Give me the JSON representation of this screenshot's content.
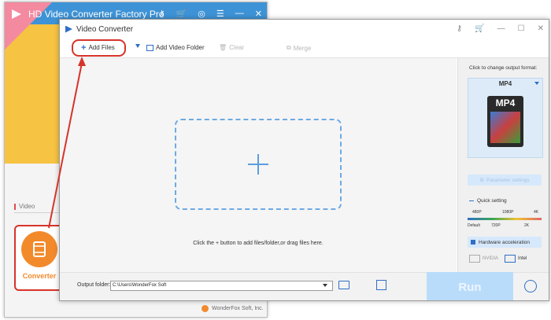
{
  "background_app": {
    "title": "HD Video Converter Factory Pro",
    "title_icons": [
      "key-icon",
      "cart-icon",
      "globe-icon",
      "menu-icon",
      "minimize-icon",
      "close-icon"
    ],
    "video_tab": "Video",
    "converter_label": "Converter",
    "footer": "WonderFox Soft, Inc."
  },
  "window": {
    "title": "Video Converter",
    "title_icons": [
      "key-icon",
      "cart-icon",
      "minimize-icon",
      "maximize-icon",
      "close-icon"
    ]
  },
  "toolbar": {
    "add_files": "Add Files",
    "add_video_folder": "Add Video Folder",
    "clear": "Clear",
    "merge": "Merge"
  },
  "drop_zone": {
    "hint": "Click the + button to add files/folder,or drag files here."
  },
  "output_panel": {
    "label": "Click to change output format:",
    "format": "MP4",
    "icon_text": "MP4",
    "parameter_settings": "Parameter settings",
    "quick_setting": "Quick setting",
    "quality_top": [
      "480P",
      "1080P",
      "4K"
    ],
    "quality_bottom": [
      "Default",
      "720P",
      "2K"
    ],
    "hardware_acceleration": "Hardware acceleration",
    "nvidia": "NVIDIA",
    "intel": "Intel"
  },
  "bottom": {
    "output_folder_label": "Output folder:",
    "output_folder_value": "C:\\Users\\WonderFox Soft",
    "run": "Run"
  },
  "colors": {
    "accent": "#2f6fc6",
    "highlight_red": "#d7332a",
    "run_button": "#b9dcfb",
    "converter_orange": "#f28a2c"
  }
}
